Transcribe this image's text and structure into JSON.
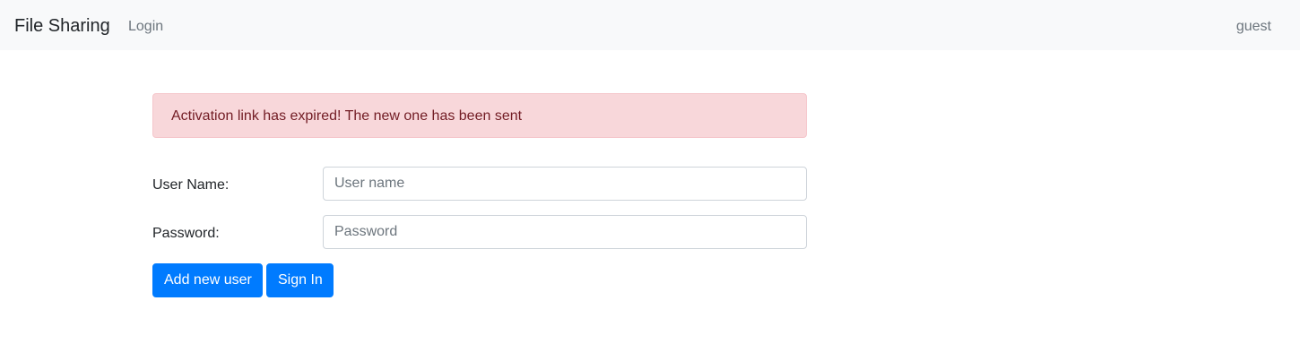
{
  "navbar": {
    "brand": "File Sharing",
    "login_link": "Login",
    "current_user": "guest"
  },
  "alert": {
    "message": "Activation link has expired! The new one has been sent",
    "color": "#f8d7da"
  },
  "form": {
    "username_label": "User Name:",
    "username_value": "",
    "username_placeholder": "User name",
    "password_label": "Password:",
    "password_value": "",
    "password_placeholder": "Password",
    "add_user_label": "Add new user",
    "sign_in_label": "Sign In"
  },
  "colors": {
    "primary": "#007bff",
    "navbar_bg": "#f8f9fa",
    "alert_text": "#721c24"
  }
}
